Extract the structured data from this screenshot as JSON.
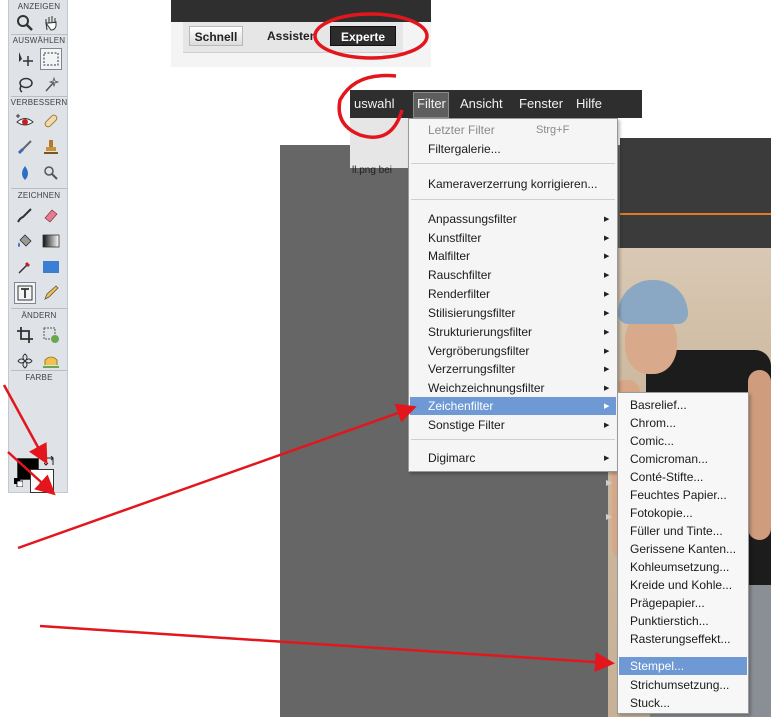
{
  "toolbar": {
    "sections": {
      "view": "ANZEIGEN",
      "select": "AUSWÄHLEN",
      "enhance": "VERBESSERN",
      "draw": "ZEICHNEN",
      "modify": "ÄNDERN",
      "color": "FARBE"
    }
  },
  "modes": {
    "quick": "Schnell",
    "guided": "Assistent",
    "expert": "Experte"
  },
  "menubar": {
    "select": "uswahl",
    "filter": "Filter",
    "view": "Ansicht",
    "window": "Fenster",
    "help": "Hilfe"
  },
  "document": {
    "tab_fragment": "ll.png bei"
  },
  "filter_menu": {
    "last_filter": "Letzter Filter",
    "last_filter_shortcut": "Strg+F",
    "filter_gallery": "Filtergalerie...",
    "camera_correction": "Kameraverzerrung korrigieren...",
    "items": [
      "Anpassungsfilter",
      "Kunstfilter",
      "Malfilter",
      "Rauschfilter",
      "Renderfilter",
      "Stilisierungsfilter",
      "Strukturierungsfilter",
      "Vergröberungsfilter",
      "Verzerrungsfilter",
      "Weichzeichnungsfilter",
      "Zeichenfilter",
      "Sonstige Filter"
    ],
    "digimarc": "Digimarc"
  },
  "sketch_submenu": {
    "items": [
      "Basrelief...",
      "Chrom...",
      "Comic...",
      "Comicroman...",
      "Conté-Stifte...",
      "Feuchtes Papier...",
      "Fotokopie...",
      "Füller und Tinte...",
      "Gerissene Kanten...",
      "Kohleumsetzung...",
      "Kreide und Kohle...",
      "Prägepapier...",
      "Punktierstich...",
      "Rasterungseffekt...",
      "Stempel...",
      "Strichumsetzung...",
      "Stuck..."
    ]
  },
  "colors": {
    "highlight": "#6e99d4",
    "annotation": "#e3161d",
    "foreground": "#000000",
    "background": "#ffffff"
  }
}
